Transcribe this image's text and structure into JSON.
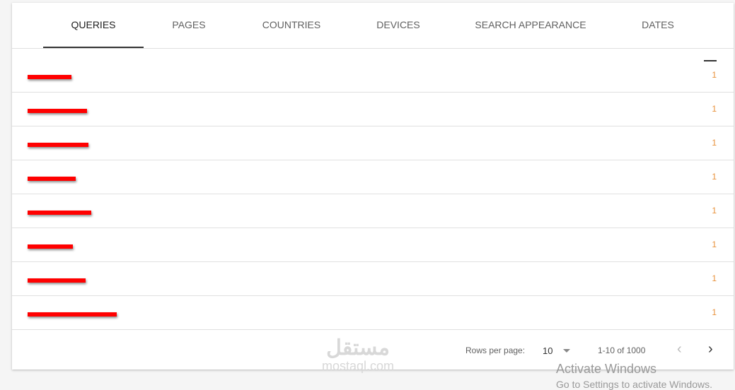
{
  "tabs": [
    {
      "label": "QUERIES",
      "active": true
    },
    {
      "label": "PAGES",
      "active": false
    },
    {
      "label": "COUNTRIES",
      "active": false
    },
    {
      "label": "DEVICES",
      "active": false
    },
    {
      "label": "SEARCH APPEARANCE",
      "active": false
    },
    {
      "label": "DATES",
      "active": false
    }
  ],
  "rows": [
    {
      "query_redacted": true,
      "value": "1"
    },
    {
      "query_redacted": true,
      "value": "1"
    },
    {
      "query_redacted": true,
      "value": "1"
    },
    {
      "query_redacted": true,
      "value": "1"
    },
    {
      "query_redacted": true,
      "value": "1"
    },
    {
      "query_redacted": true,
      "value": "1"
    },
    {
      "query_redacted": true,
      "value": "1"
    },
    {
      "query_redacted": true,
      "value": "1"
    }
  ],
  "pagination": {
    "rows_per_page_label": "Rows per page:",
    "rows_per_page": "10",
    "range": "1-10 of 1000",
    "prev_icon": "chevron-left",
    "next_icon": "chevron-right"
  },
  "watermark": {
    "arabic": "مستقل",
    "latin": "mostaql.com"
  },
  "activation": {
    "title": "Activate Windows",
    "subtitle": "Go to Settings to activate Windows."
  },
  "colors": {
    "value": "#e8913a",
    "redaction": "#ff0000"
  }
}
